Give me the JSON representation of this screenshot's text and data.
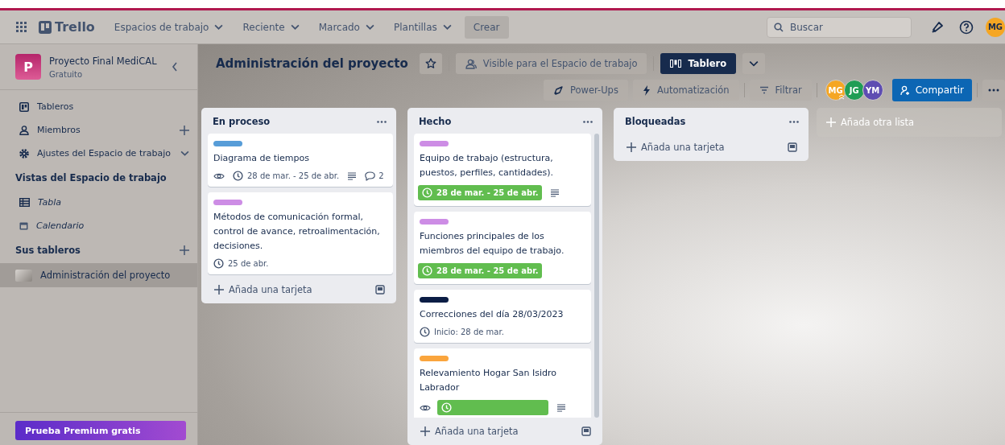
{
  "topbar": {
    "logo": "Trello",
    "menus": [
      {
        "label": "Espacios de trabajo"
      },
      {
        "label": "Reciente"
      },
      {
        "label": "Marcado"
      },
      {
        "label": "Plantillas"
      }
    ],
    "create": "Crear",
    "search": {
      "placeholder": "Buscar"
    },
    "avatar": {
      "initials": "MG",
      "color": "#f5a623"
    }
  },
  "sidebar": {
    "workspace": {
      "letter": "P",
      "name": "Proyecto Final MediCAL",
      "plan": "Gratuito"
    },
    "items": [
      {
        "kind": "boards",
        "label": "Tableros",
        "italic": false
      },
      {
        "kind": "members",
        "label": "Miembros",
        "italic": false
      },
      {
        "kind": "settings",
        "label": "Ajustes del Espacio de trabajo",
        "italic": false
      }
    ],
    "views_title": "Vistas del Espacio de trabajo",
    "views": [
      {
        "kind": "table",
        "label": "Tabla",
        "italic": true
      },
      {
        "kind": "calendar",
        "label": "Calendario",
        "italic": true
      }
    ],
    "boards_title": "Sus tableros",
    "boards": [
      {
        "label": "Administración del proyecto",
        "selected": true
      }
    ],
    "premium": "Prueba Premium gratis"
  },
  "board": {
    "title": "Administración del proyecto",
    "starred": false,
    "visibility": "Visible para el Espacio de trabajo",
    "view": "Tablero",
    "powerups": "Power-Ups",
    "automation": "Automatización",
    "filter": "Filtrar",
    "members": [
      {
        "initials": "MG",
        "color": "#f5a623",
        "admin": true
      },
      {
        "initials": "JG",
        "color": "#1f9d55",
        "admin": false
      },
      {
        "initials": "YM",
        "color": "#5e4db2",
        "admin": false
      }
    ],
    "share": "Compartir",
    "lists": [
      {
        "title": "En proceso",
        "add": "Añada una tarjeta",
        "scroll": false,
        "cards": [
          {
            "color": "#579dd8",
            "title": "Diagrama de tiempos",
            "badges": [
              {
                "kind": "watch"
              },
              {
                "kind": "dates",
                "text": "28 de mar. - 25 de abr.",
                "complete": false
              },
              {
                "kind": "description"
              },
              {
                "kind": "comments",
                "text": "2"
              }
            ]
          },
          {
            "color": "#cd8de5",
            "title": "Métodos de comunicación formal, control de avance, retroalimentación, decisiones.",
            "badges": [
              {
                "kind": "dates",
                "text": "25 de abr.",
                "complete": false
              }
            ]
          }
        ]
      },
      {
        "title": "Hecho",
        "add": "Añada una tarjeta",
        "scroll": true,
        "cards": [
          {
            "color": "#cd8de5",
            "title": "Equipo de trabajo (estructura, puestos, perfiles, cantidades).",
            "badges": [
              {
                "kind": "dates",
                "text": "28 de mar. - 25 de abr.",
                "complete": true
              },
              {
                "kind": "description"
              }
            ]
          },
          {
            "color": "#cd8de5",
            "title": "Funciones principales de los miembros del equipo de trabajo.",
            "badges": [
              {
                "kind": "dates",
                "text": "28 de mar. - 25 de abr.",
                "complete": true
              }
            ]
          },
          {
            "color": "#0b1d45",
            "title": "Correcciones del día 28/03/2023",
            "badges": [
              {
                "kind": "dates",
                "text": "Inicio: 28 de mar.",
                "complete": false
              }
            ]
          },
          {
            "color": "#faa53d",
            "title": "Relevamiento Hogar San Isidro Labrador",
            "badges": [
              {
                "kind": "watch"
              },
              {
                "kind": "dates",
                "complete": true
              },
              {
                "kind": "description"
              }
            ]
          }
        ]
      },
      {
        "title": "Bloqueadas",
        "add": "Añada una tarjeta",
        "scroll": false
      }
    ],
    "add_list": "Añada otra lista"
  }
}
